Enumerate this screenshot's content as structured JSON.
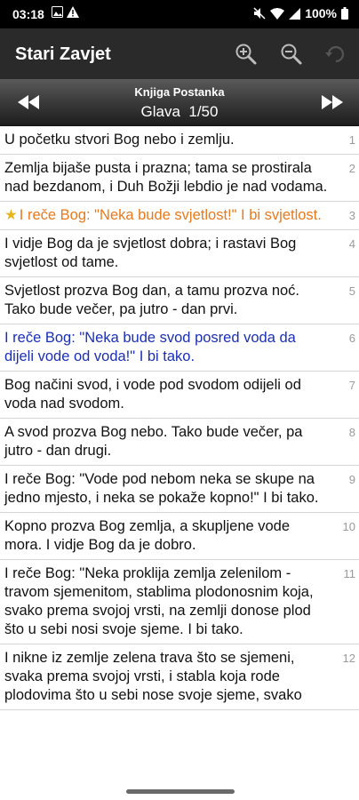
{
  "status": {
    "time": "03:18",
    "battery": "100%",
    "icons": [
      "photo-icon",
      "alert-icon",
      "mute-icon",
      "wifi-icon",
      "signal-icon",
      "battery-icon"
    ]
  },
  "appbar": {
    "title": "Stari Zavjet",
    "actions": [
      "zoom-in-icon",
      "zoom-out-icon",
      "rotate-icon"
    ]
  },
  "chapter_nav": {
    "book": "Knjiga Postanka",
    "chapter": "Glava  1/50",
    "prev_icon": "rewind-icon",
    "next_icon": "fast-forward-icon"
  },
  "colors": {
    "highlight_orange": "#e8791c",
    "highlight_blue": "#1a2fb5",
    "star": "#e8b51c"
  },
  "verses": [
    {
      "num": "1",
      "text": "U početku stvori Bog nebo i zemlju."
    },
    {
      "num": "2",
      "text": "Zemlja bijaše pusta i prazna; tama se prostirala nad bezdanom, i Duh Božji lebdio je nad vodama."
    },
    {
      "num": "3",
      "text": "I reče Bog: \"Neka bude svjetlost!\" I bi svjetlost.",
      "style": "orange",
      "starred": true
    },
    {
      "num": "4",
      "text": "I vidje Bog da je svjetlost dobra; i rastavi Bog svjetlost od tame."
    },
    {
      "num": "5",
      "text": "Svjetlost prozva Bog dan, a tamu prozva noć. Tako bude večer, pa jutro - dan prvi."
    },
    {
      "num": "6",
      "text": "I reče Bog: \"Neka bude svod posred voda da dijeli vode od voda!\" I bi tako.",
      "style": "blue"
    },
    {
      "num": "7",
      "text": "Bog načini svod, i vode pod svodom odijeli od voda nad svodom."
    },
    {
      "num": "8",
      "text": "A svod prozva Bog nebo. Tako bude večer, pa jutro - dan drugi."
    },
    {
      "num": "9",
      "text": "I reče Bog: \"Vode pod nebom neka se skupe na jedno mjesto, i neka se pokaže kopno!\" I bi tako."
    },
    {
      "num": "10",
      "text": "Kopno prozva Bog zemlja, a skupljene vode mora. I vidje Bog da je dobro."
    },
    {
      "num": "11",
      "text": "I reče Bog: \"Neka proklija zemlja zelenilom - travom sjemenitom, stablima plodonosnim koja, svako prema svojoj vrsti, na zemlji donose plod što u sebi nosi svoje sjeme. I bi tako."
    },
    {
      "num": "12",
      "text": "I nikne iz zemlje zelena trava što se sjemeni, svaka prema svojoj vrsti, i stabla koja rode plodovima što u sebi nose svoje sjeme, svako"
    }
  ]
}
